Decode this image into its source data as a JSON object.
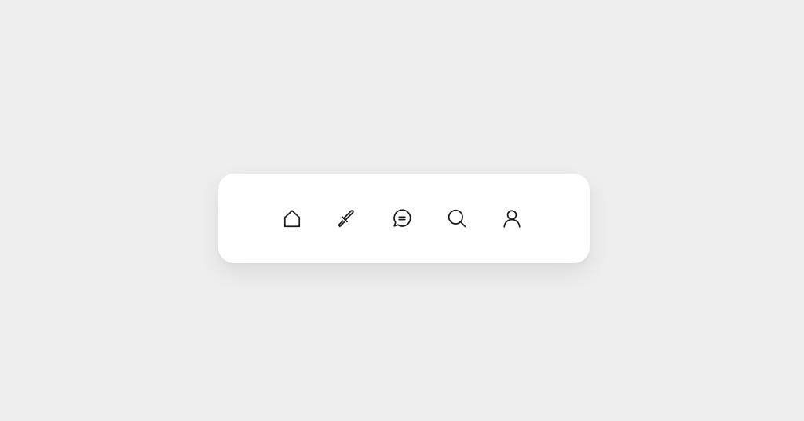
{
  "colors": {
    "page_background": "#eeeeee",
    "bar_background": "#ffffff",
    "icon_stroke": "#1a1a1a"
  },
  "tab_bar": {
    "items": [
      {
        "id": "home",
        "icon": "home-icon"
      },
      {
        "id": "explore",
        "icon": "sword-icon"
      },
      {
        "id": "messages",
        "icon": "chat-bubble-icon"
      },
      {
        "id": "search",
        "icon": "search-icon"
      },
      {
        "id": "profile",
        "icon": "user-icon"
      }
    ]
  }
}
